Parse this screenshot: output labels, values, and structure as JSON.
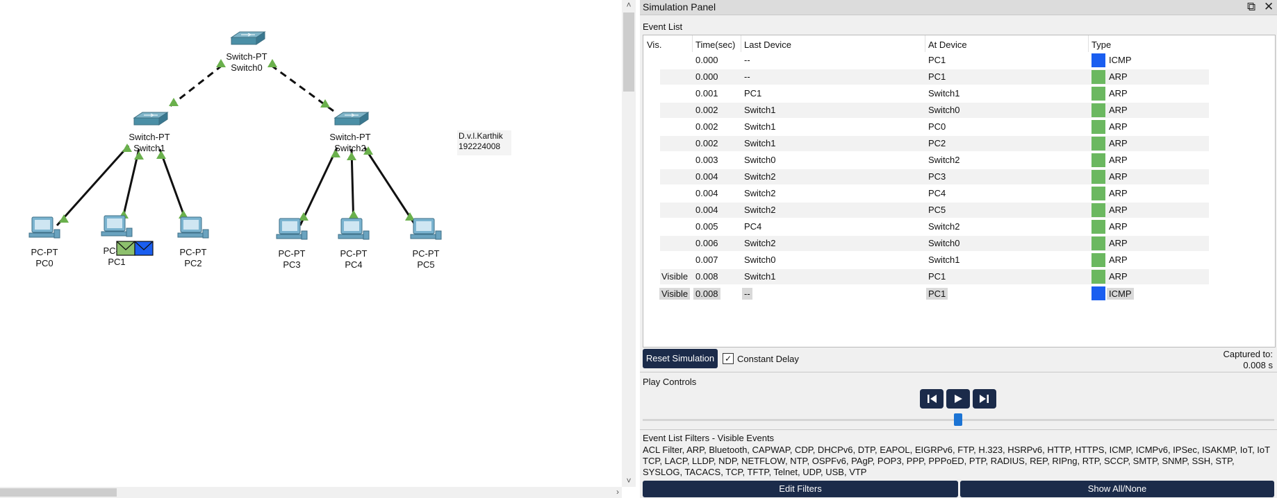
{
  "workspace": {
    "devices": [
      {
        "id": "switch0",
        "model": "Switch-PT",
        "name": "Switch0"
      },
      {
        "id": "switch1",
        "model": "Switch-PT",
        "name": "Switch1"
      },
      {
        "id": "switch2",
        "model": "Switch-PT",
        "name": "Switch2"
      },
      {
        "id": "pc0",
        "model": "PC-PT",
        "name": "PC0"
      },
      {
        "id": "pc1",
        "model": "PC-PT",
        "name": "PC1"
      },
      {
        "id": "pc2",
        "model": "PC-PT",
        "name": "PC2"
      },
      {
        "id": "pc3",
        "model": "PC-PT",
        "name": "PC3"
      },
      {
        "id": "pc4",
        "model": "PC-PT",
        "name": "PC4"
      },
      {
        "id": "pc5",
        "model": "PC-PT",
        "name": "PC5"
      }
    ],
    "note": {
      "line1": "D.v.l.Karthik",
      "line2": "192224008"
    },
    "colors": {
      "link_ok": "#6ab04c",
      "switch": "#4b8fa6",
      "pc": "#7ab3cf"
    }
  },
  "panel": {
    "title": "Simulation Panel",
    "event_list_label": "Event List",
    "columns": {
      "vis": "Vis.",
      "time": "Time(sec)",
      "last": "Last Device",
      "at": "At Device",
      "type": "Type"
    },
    "events": [
      {
        "vis": "",
        "time": "0.000",
        "last": "--",
        "at": "PC1",
        "type": "ICMP",
        "color": "#1a5ef0"
      },
      {
        "vis": "",
        "time": "0.000",
        "last": "--",
        "at": "PC1",
        "type": "ARP",
        "color": "#6bb860"
      },
      {
        "vis": "",
        "time": "0.001",
        "last": "PC1",
        "at": "Switch1",
        "type": "ARP",
        "color": "#6bb860"
      },
      {
        "vis": "",
        "time": "0.002",
        "last": "Switch1",
        "at": "Switch0",
        "type": "ARP",
        "color": "#6bb860"
      },
      {
        "vis": "",
        "time": "0.002",
        "last": "Switch1",
        "at": "PC0",
        "type": "ARP",
        "color": "#6bb860"
      },
      {
        "vis": "",
        "time": "0.002",
        "last": "Switch1",
        "at": "PC2",
        "type": "ARP",
        "color": "#6bb860"
      },
      {
        "vis": "",
        "time": "0.003",
        "last": "Switch0",
        "at": "Switch2",
        "type": "ARP",
        "color": "#6bb860"
      },
      {
        "vis": "",
        "time": "0.004",
        "last": "Switch2",
        "at": "PC3",
        "type": "ARP",
        "color": "#6bb860"
      },
      {
        "vis": "",
        "time": "0.004",
        "last": "Switch2",
        "at": "PC4",
        "type": "ARP",
        "color": "#6bb860"
      },
      {
        "vis": "",
        "time": "0.004",
        "last": "Switch2",
        "at": "PC5",
        "type": "ARP",
        "color": "#6bb860"
      },
      {
        "vis": "",
        "time": "0.005",
        "last": "PC4",
        "at": "Switch2",
        "type": "ARP",
        "color": "#6bb860"
      },
      {
        "vis": "",
        "time": "0.006",
        "last": "Switch2",
        "at": "Switch0",
        "type": "ARP",
        "color": "#6bb860"
      },
      {
        "vis": "",
        "time": "0.007",
        "last": "Switch0",
        "at": "Switch1",
        "type": "ARP",
        "color": "#6bb860"
      },
      {
        "vis": "Visible",
        "time": "0.008",
        "last": "Switch1",
        "at": "PC1",
        "type": "ARP",
        "color": "#6bb860"
      },
      {
        "vis": "Visible",
        "time": "0.008",
        "last": "--",
        "at": "PC1",
        "type": "ICMP",
        "color": "#1a5ef0",
        "selected": true
      }
    ],
    "reset_label": "Reset Simulation",
    "constant_delay_label": "Constant Delay",
    "constant_delay_checked": true,
    "captured_label": "Captured to:",
    "captured_value": "0.008 s",
    "play_controls_label": "Play Controls",
    "filters_label": "Event List Filters - Visible Events",
    "filters_text": "ACL Filter, ARP, Bluetooth, CAPWAP, CDP, DHCPv6, DTP, EAPOL, EIGRPv6, FTP, H.323, HSRPv6, HTTP, HTTPS, ICMP, ICMPv6, IPSec, ISAKMP, IoT, IoT TCP, LACP, LLDP, NDP, NETFLOW, NTP, OSPFv6, PAgP, POP3, PPP, PPPoED, PTP, RADIUS, REP, RIPng, RTP, SCCP, SMTP, SNMP, SSH, STP, SYSLOG, TACACS, TCP, TFTP, Telnet, UDP, USB, VTP",
    "edit_filters_label": "Edit Filters",
    "show_all_label": "Show All/None"
  }
}
